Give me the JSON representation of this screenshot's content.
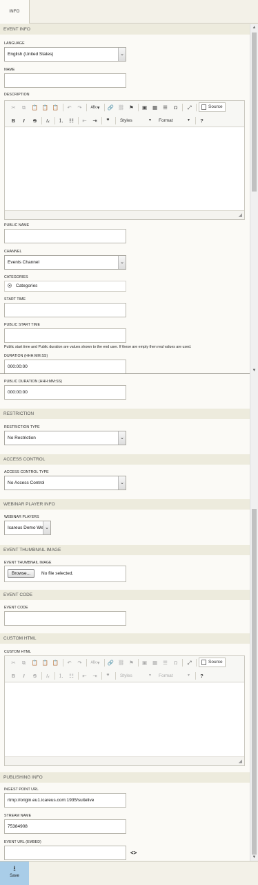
{
  "tabs": [
    {
      "label": "INFO"
    }
  ],
  "event_info": {
    "section": "EVENT INFO",
    "language_label": "LANGUAGE",
    "language_value": "English (United States)",
    "name_label": "NAME",
    "name_value": "",
    "description_label": "DESCRIPTION",
    "public_name_label": "PUBLIC NAME",
    "channel_label": "CHANNEL",
    "channel_value": "Events Channel",
    "categories_label": "CATEGORIES",
    "categories_option": "Categories",
    "start_time_label": "START TIME",
    "public_start_time_label": "PUBLIC START TIME",
    "public_note": "Public start time and Public duration are values shown to the end user. If these are empty then real values are used.",
    "duration_label": "DURATION (HHH:MM:SS)",
    "duration_value": "000:00:00",
    "public_duration_label": "PUBLIC DURATION (HHH:MM:SS)",
    "public_duration_value": "000:00:00"
  },
  "editor": {
    "styles_label": "Styles",
    "format_label": "Format",
    "source_label": "Source"
  },
  "restriction": {
    "section": "RESTRICTION",
    "type_label": "RESTRICTION TYPE",
    "type_value": "No Restriction"
  },
  "access_control": {
    "section": "ACCESS CONTROL",
    "type_label": "ACCESS CONTROL TYPE",
    "type_value": "No Access Control"
  },
  "webinar": {
    "section": "WEBINAR PLAYER INFO",
    "players_label": "WEBINAR PLAYERS",
    "players_value": "Icareus Demo We"
  },
  "thumbnail": {
    "section": "EVENT THUMBNAIL IMAGE",
    "label": "EVENT THUMBNAIL IMAGE",
    "browse_label": "Browse...",
    "file_status": "No file selected."
  },
  "event_code": {
    "section": "EVENT CODE",
    "label": "EVENT CODE",
    "value": ""
  },
  "custom_html": {
    "section": "CUSTOM HTML",
    "label": "CUSTOM HTML"
  },
  "publishing": {
    "section": "PUBLISHING INFO",
    "ingest_label": "INGEST POINT URL",
    "ingest_value": "rtmp://origin.eu1.icareus.com:1935/suitelive",
    "stream_label": "STREAM NAME",
    "stream_value": "75384908",
    "embed_label": "EVENT URL (EMBED)",
    "embed_value": "",
    "embed_icon": "<>"
  },
  "footer": {
    "save_label": "Save"
  }
}
